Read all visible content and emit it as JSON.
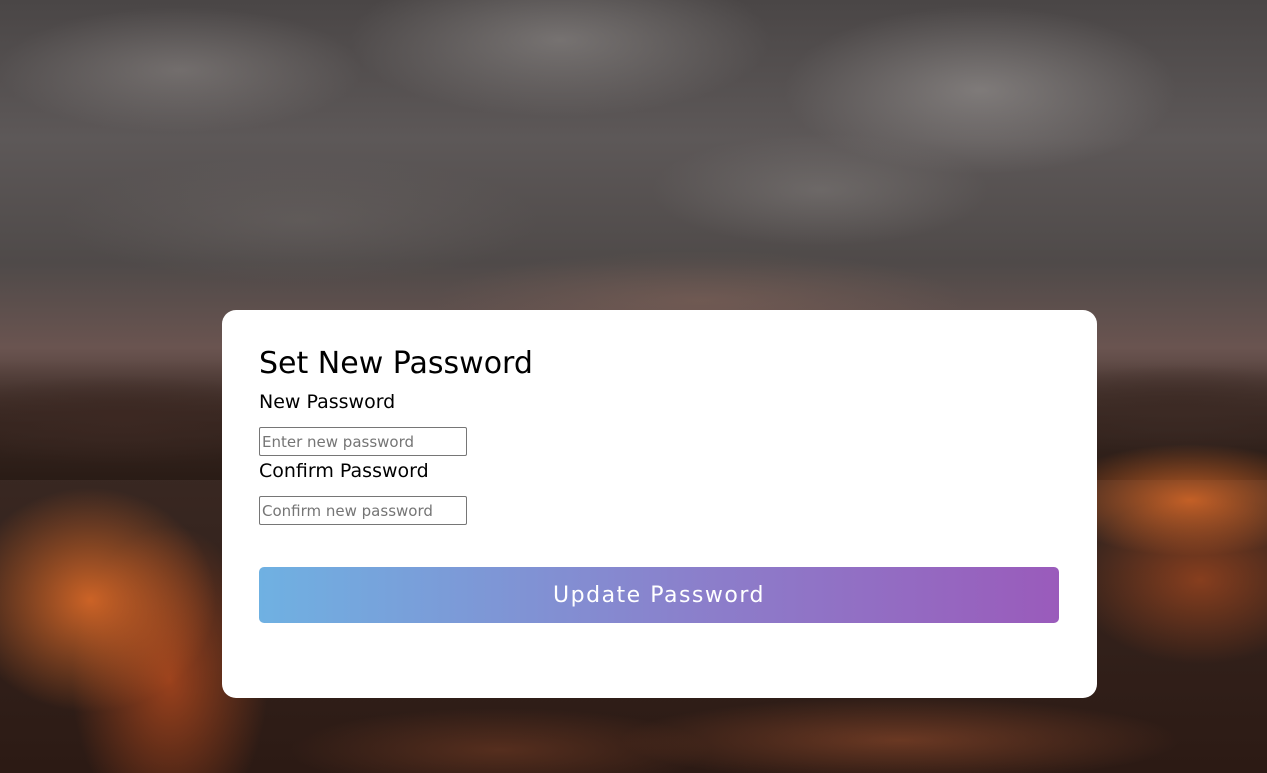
{
  "form": {
    "title": "Set New Password",
    "new_password_label": "New Password",
    "new_password_placeholder": "Enter new password",
    "new_password_value": "",
    "confirm_password_label": "Confirm Password",
    "confirm_password_placeholder": "Confirm new password",
    "confirm_password_value": "",
    "submit_label": "Update Password"
  },
  "theme": {
    "card_background": "#ffffff",
    "button_gradient_start": "#6fb1e2",
    "button_gradient_end": "#9a5bbb",
    "button_text_color": "#ffffff",
    "background_image": "volcanic-landscape-with-lava-under-cloudy-sky"
  }
}
